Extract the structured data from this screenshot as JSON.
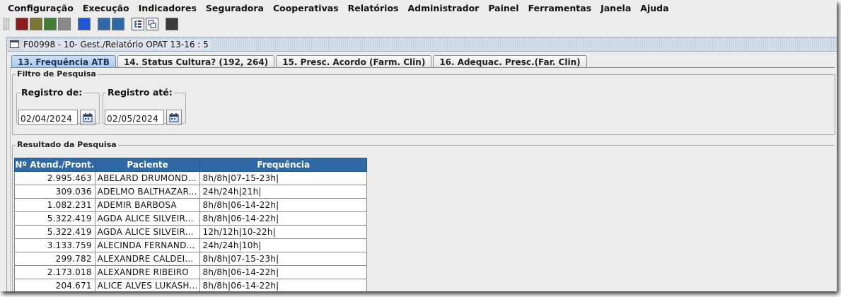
{
  "menu": [
    "Configuração",
    "Execução",
    "Indicadores",
    "Seguradora",
    "Cooperativas",
    "Relatórios",
    "Administrador",
    "Painel",
    "Ferramentas",
    "Janela",
    "Ajuda"
  ],
  "toolbar_colors": [
    "#8d1d1d",
    "#7a7632",
    "#3f7d34",
    "#8a8a8a",
    "#1f57d6",
    "#2f6aa6",
    "#2f6aa6",
    "#3a3a3a"
  ],
  "window": {
    "title": "F00998 - 10- Gest./Relatório OPAT 13-16 : 5"
  },
  "tabs": [
    "13. Frequência ATB",
    "14. Status Cultura? (192, 264)",
    "15. Presc. Acordo (Farm. Clin)",
    "16. Adequac. Presc.(Far. Clin)"
  ],
  "filter": {
    "legend": "Filtro de Pesquisa",
    "from_label": "Registro de:",
    "from_value": "02/04/2024",
    "to_label": "Registro até:",
    "to_value": "02/05/2024"
  },
  "result": {
    "legend": "Resultado da Pesquisa",
    "columns": [
      "Nº Atend./Pront.",
      "Paciente",
      "Frequência"
    ],
    "rows": [
      [
        "2.995.463",
        "ABELARD DRUMOND...",
        "8h/8h|07-15-23h|"
      ],
      [
        "309.036",
        "ADELMO BALTHAZAR...",
        "24h/24h|21h|"
      ],
      [
        "1.082.231",
        "ADEMIR BARBOSA",
        "8h/8h|06-14-22h|"
      ],
      [
        "5.322.419",
        "AGDA ALICE SILVEIR...",
        "8h/8h|06-14-22h|"
      ],
      [
        "5.322.419",
        "AGDA ALICE SILVEIR...",
        "12h/12h|10-22h|"
      ],
      [
        "3.133.759",
        "ALECINDA FERNAND...",
        "24h/24h|10h|"
      ],
      [
        "299.782",
        "ALEXANDRE CALDEI...",
        "8h/8h|07-15-23h|"
      ],
      [
        "2.173.018",
        "ALEXANDRE RIBEIRO",
        "8h/8h|06-14-22h|"
      ],
      [
        "204.671",
        "ALICE ALVES LUKASH...",
        "8h/8h|06-14-22h|"
      ]
    ]
  }
}
